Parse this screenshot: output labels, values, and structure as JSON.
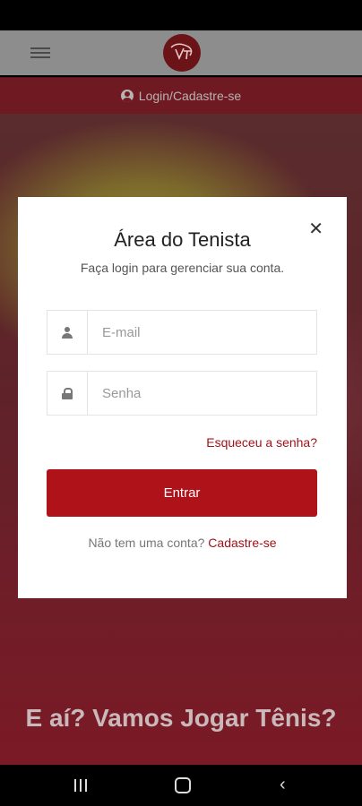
{
  "header": {
    "login_label": "Login/Cadastre-se"
  },
  "modal": {
    "title": "Área do Tenista",
    "subtitle": "Faça login para gerenciar sua conta.",
    "close_glyph": "✕",
    "email_placeholder": "E-mail",
    "password_placeholder": "Senha",
    "forgot_label": "Esqueceu a senha?",
    "submit_label": "Entrar",
    "signup_prompt": "Não tem uma conta?",
    "signup_link": "Cadastre-se"
  },
  "hero": {
    "title": "E aí? Vamos Jogar Tênis?"
  },
  "colors": {
    "brand": "#b0121a",
    "link": "#a01219"
  },
  "icons": [
    "menu-icon",
    "logo",
    "user-icon",
    "close-icon",
    "person-icon",
    "lock-icon",
    "nav-recent-icon",
    "nav-home-icon",
    "nav-back-icon"
  ]
}
